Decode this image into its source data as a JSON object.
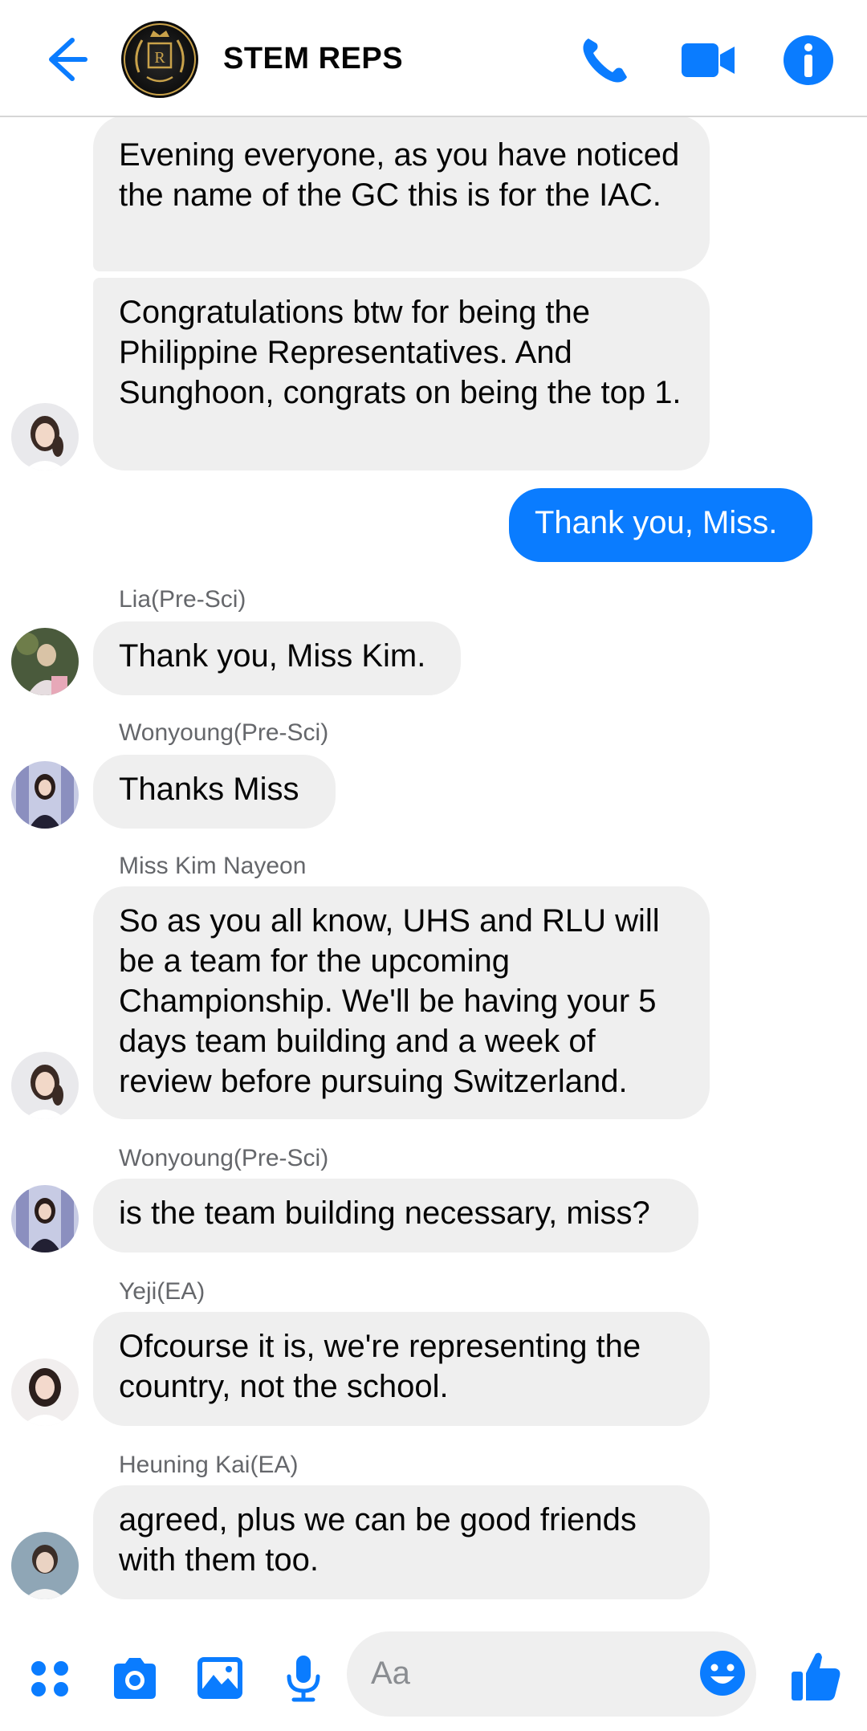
{
  "header": {
    "title": "STEM REPS",
    "back_icon": "arrow-left-icon",
    "call_icon": "phone-icon",
    "video_icon": "video-camera-icon",
    "info_icon": "info-icon",
    "accent": "#0a7cff"
  },
  "messages": [
    {
      "sender": "",
      "text": "Evening everyone, as you have noticed the name of the GC this is for the IAC."
    },
    {
      "sender": "",
      "text": "Congratulations btw for being the Philippine Representatives. And Sunghoon, congrats on being the top 1."
    },
    {
      "sender": "",
      "text": "Thank you, Miss."
    },
    {
      "sender": "Lia(Pre-Sci)",
      "text": "Thank you, Miss Kim."
    },
    {
      "sender": "Wonyoung(Pre-Sci)",
      "text": "Thanks Miss"
    },
    {
      "sender": "Miss Kim Nayeon",
      "text": "So as you all know, UHS and RLU will be a team for the upcoming Championship. We'll be having your 5 days team building and a week of review before pursuing Switzerland."
    },
    {
      "sender": "Wonyoung(Pre-Sci)",
      "text": "is the team building necessary, miss?"
    },
    {
      "sender": "Yeji(EA)",
      "text": "Ofcourse it is, we're representing the country, not the school."
    },
    {
      "sender": "Heuning Kai(EA)",
      "text": "agreed, plus we can be good friends with them too."
    }
  ],
  "composer": {
    "placeholder": "Aa",
    "icons": [
      "grid-menu-icon",
      "camera-icon",
      "image-icon",
      "microphone-icon",
      "emoji-icon",
      "thumbs-up-icon"
    ]
  },
  "colors": {
    "bubble_other": "#efefef",
    "bubble_mine": "#0a7cff",
    "sender_label": "#65676b"
  }
}
